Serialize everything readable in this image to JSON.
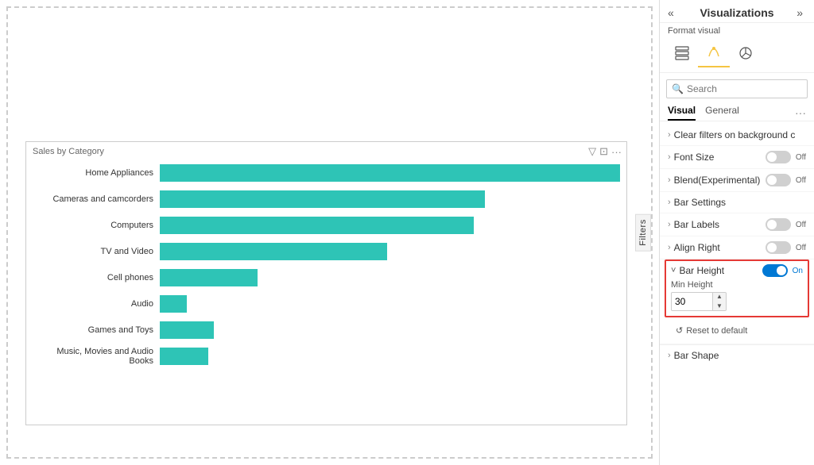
{
  "panel": {
    "title": "Visualizations",
    "collapse_icon": "«",
    "expand_icon": "»",
    "format_visual_label": "Format visual",
    "search_placeholder": "Search",
    "tabs": [
      {
        "id": "visual",
        "label": "Visual",
        "active": true
      },
      {
        "id": "general",
        "label": "General",
        "active": false
      }
    ],
    "tab_more": "···",
    "options": [
      {
        "id": "clear-filters",
        "label": "Clear filters on background c",
        "toggle": null
      },
      {
        "id": "font-size",
        "label": "Font Size",
        "toggle": "off"
      },
      {
        "id": "blend",
        "label": "Blend(Experimental)",
        "toggle": "off"
      },
      {
        "id": "bar-settings",
        "label": "Bar Settings",
        "toggle": null
      },
      {
        "id": "bar-labels",
        "label": "Bar Labels",
        "toggle": "off"
      },
      {
        "id": "align-right",
        "label": "Align Right",
        "toggle": "off"
      }
    ],
    "bar_height": {
      "label": "Bar Height",
      "toggle": "on",
      "toggle_label_on": "On",
      "min_height_label": "Min Height",
      "min_height_value": "30"
    },
    "reset_label": "Reset to default",
    "bar_shape": {
      "label": "Bar Shape"
    }
  },
  "chart": {
    "title": "Sales by Category",
    "bars": [
      {
        "label": "Home Appliances",
        "value": 85
      },
      {
        "label": "Cameras and camcorders",
        "value": 60
      },
      {
        "label": "Computers",
        "value": 58
      },
      {
        "label": "TV and Video",
        "value": 42
      },
      {
        "label": "Cell phones",
        "value": 18
      },
      {
        "label": "Audio",
        "value": 5
      },
      {
        "label": "Games and Toys",
        "value": 10
      },
      {
        "label": "Music, Movies and Audio Books",
        "value": 9
      }
    ],
    "bar_color": "#2EC4B6"
  },
  "filters": {
    "label": "Filters"
  },
  "icons": {
    "search": "🔍",
    "chevron_right": "›",
    "chevron_down": "˅",
    "filter": "▽",
    "expand_chart": "⊡",
    "more_chart": "···",
    "reset_icon": "↺"
  }
}
